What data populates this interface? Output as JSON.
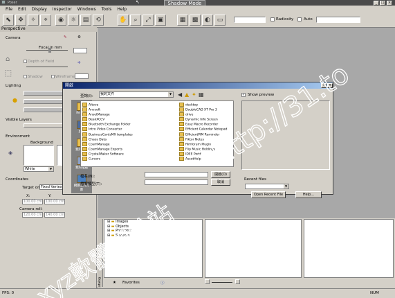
{
  "app": {
    "title_left": "Poser",
    "mode_label": "Shadow Mode"
  },
  "menu": [
    "File",
    "Edit",
    "Display",
    "Inspector",
    "Windows",
    "Tools",
    "Help"
  ],
  "toolbar": {
    "radiosity_label": "Radiosity",
    "auto_label": "Auto"
  },
  "left_panel": {
    "perspective": "Perspective",
    "camera": "Camera",
    "focal": "Focal in mm",
    "depth": "Depth of Field",
    "shadow": "Shadow",
    "wireframe": "Wireframe",
    "lighting": "Lighting",
    "visible_layers": "Visible Layers",
    "environment": "Environment",
    "background": "Background",
    "background_value": "White",
    "coordinates": "Coordinates",
    "target_on": "Target on:",
    "target_value": "Fixed Vertex",
    "x": "X:",
    "y": "Y:",
    "x_val": "100.00 cm",
    "y_val": "100.00 cm",
    "camera_roll": "Camera roll:",
    "z_val": "120.00 cm",
    "w_val": "140.00 cm"
  },
  "dialog": {
    "title": "開啟",
    "lookin_label": "查詢(I):",
    "lookin_value": "我的文件",
    "places": [
      "Recent",
      "桌面",
      "我的文件",
      "我的電腦",
      "網路上的芳鄰"
    ],
    "files_col1": [
      "Altova",
      "Anvsoft",
      "AnsetManage",
      "BeakXCCV",
      "Bluetooth Exchange Folder",
      "Intro Video Converter",
      "BusinessCardsMX templates",
      "Chaos Data",
      "CosmManage",
      "CosmManage Exports",
      "CrystalMaker Software",
      "Cursors"
    ],
    "files_col2": [
      "desktop",
      "DoubleCAD XT Pro 3",
      "drive",
      "Dynamic Info Screen",
      "Easy Macro Recorder",
      "Efficient Calendar Notepad",
      "EfficientPIM Reminder",
      "Fiktor Notes",
      "filmforum Plugin",
      "Flip Music Holdings",
      "IDEE Portf",
      "AssetHelp"
    ],
    "filename_label": "檔名(N):",
    "filetype_label": "檔案類型(T):",
    "open_btn": "開啟(O)",
    "cancel_btn": "取消",
    "show_label": "Show preview",
    "recent_files": "Recent files",
    "open_recent": "Open Recent File",
    "help_btn": "Help..."
  },
  "tree": [
    "Images",
    "Objects",
    "Postcards",
    "Shaders"
  ],
  "catalog": {
    "favorites": "Favorites",
    "catalog_label": "Catalog"
  },
  "status": {
    "fps": "FPS: 0",
    "num": "NUM"
  },
  "watermark": {
    "text1": "xyz軟體補給站",
    "text2": "http://31.to"
  }
}
